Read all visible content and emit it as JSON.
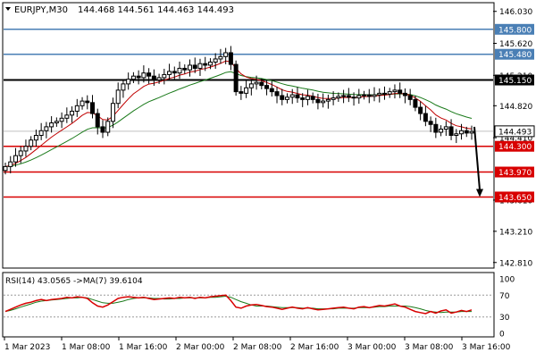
{
  "header": {
    "symbol": "EURJPY,M30",
    "ohlc": "144.468 144.561 144.463 144.493"
  },
  "rsi_header": "RSI(14) 43.0565  ->MA(7) 39.6104",
  "colors": {
    "bull": "#000000",
    "bear": "#000000",
    "ma_fast": "#c00000",
    "ma_slow": "#1a7a1a",
    "resistance_blue": "#4a7fb5",
    "pivot": "#000000",
    "support_red": "#d80000",
    "rsi_line": "#d80000",
    "rsi_ma": "#1a7a1a",
    "arrow": "#000000"
  },
  "chart_data": [
    {
      "type": "candlestick",
      "title": "EURJPY,M30",
      "ylim": [
        142.75,
        146.13
      ],
      "y_ticks": [
        "146.030",
        "145.620",
        "145.210",
        "144.820",
        "144.410",
        "143.610",
        "143.210",
        "142.810"
      ],
      "x_tick_labels": [
        "1 Mar 2023",
        "1 Mar 08:00",
        "1 Mar 16:00",
        "2 Mar 00:00",
        "2 Mar 08:00",
        "2 Mar 16:00",
        "3 Mar 00:00",
        "3 Mar 08:00",
        "3 Mar 16:00"
      ],
      "hlines": [
        {
          "value": 145.8,
          "label": "145.800",
          "kind": "resistance_blue"
        },
        {
          "value": 145.48,
          "label": "145.480",
          "kind": "resistance_blue"
        },
        {
          "value": 145.15,
          "label": "145.150",
          "kind": "pivot"
        },
        {
          "value": 144.3,
          "label": "144.300",
          "kind": "support_red"
        },
        {
          "value": 143.97,
          "label": "143.970",
          "kind": "support_red"
        },
        {
          "value": 143.65,
          "label": "143.650",
          "kind": "support_red"
        }
      ],
      "current_price": {
        "value": 144.493,
        "label": "144.493"
      },
      "arrow": {
        "from": 144.55,
        "to": 143.65
      },
      "close": [
        144.04,
        144.1,
        144.18,
        144.24,
        144.3,
        144.38,
        144.44,
        144.5,
        144.55,
        144.6,
        144.62,
        144.66,
        144.7,
        144.75,
        144.82,
        144.88,
        144.86,
        144.72,
        144.55,
        144.48,
        144.62,
        144.85,
        145.02,
        145.1,
        145.16,
        145.2,
        145.18,
        145.24,
        145.2,
        145.15,
        145.18,
        145.22,
        145.26,
        145.24,
        145.3,
        145.28,
        145.34,
        145.3,
        145.36,
        145.34,
        145.38,
        145.42,
        145.45,
        145.5,
        145.35,
        145.0,
        144.98,
        145.05,
        145.1,
        145.12,
        145.08,
        145.04,
        145.0,
        144.95,
        144.9,
        144.93,
        144.96,
        144.92,
        144.9,
        144.94,
        144.9,
        144.86,
        144.88,
        144.9,
        144.92,
        144.94,
        144.95,
        144.93,
        144.92,
        144.95,
        144.96,
        144.94,
        144.96,
        144.98,
        144.97,
        145.0,
        145.02,
        144.98,
        144.95,
        144.9,
        144.8,
        144.72,
        144.62,
        144.58,
        144.48,
        144.52,
        144.55,
        144.44,
        144.46,
        144.5,
        144.47,
        144.49
      ],
      "rsi": {
        "ylim": [
          0,
          100
        ],
        "levels": [
          70,
          30
        ],
        "y_ticks": [
          "100",
          "70",
          "30",
          "0"
        ],
        "rsi_values": [
          40,
          44,
          48,
          52,
          55,
          57,
          60,
          62,
          60,
          62,
          63,
          64,
          66,
          65,
          67,
          66,
          64,
          56,
          50,
          48,
          52,
          58,
          64,
          66,
          67,
          66,
          65,
          66,
          64,
          62,
          63,
          64,
          65,
          64,
          66,
          65,
          66,
          64,
          66,
          65,
          67,
          68,
          69,
          70,
          60,
          48,
          46,
          50,
          52,
          53,
          51,
          49,
          48,
          46,
          44,
          46,
          48,
          46,
          45,
          47,
          45,
          43,
          44,
          45,
          46,
          47,
          48,
          46,
          45,
          48,
          49,
          47,
          49,
          51,
          50,
          52,
          54,
          50,
          48,
          44,
          40,
          38,
          36,
          40,
          37,
          41,
          43,
          37,
          39,
          42,
          40,
          43
        ],
        "ma_values": [
          40,
          42,
          45,
          48,
          51,
          54,
          57,
          59,
          60,
          61,
          62,
          63,
          64,
          65,
          65,
          66,
          65,
          62,
          59,
          56,
          55,
          55,
          57,
          59,
          62,
          64,
          65,
          65,
          65,
          64,
          64,
          63,
          63,
          64,
          64,
          65,
          65,
          65,
          65,
          65,
          66,
          66,
          67,
          68,
          66,
          62,
          58,
          55,
          52,
          50,
          50,
          50,
          49,
          48,
          47,
          47,
          47,
          47,
          46,
          46,
          46,
          45,
          45,
          45,
          45,
          46,
          46,
          46,
          46,
          47,
          47,
          47,
          48,
          49,
          49,
          50,
          50,
          50,
          50,
          49,
          47,
          45,
          42,
          40,
          39,
          38,
          39,
          39,
          39,
          40,
          40,
          40
        ]
      }
    }
  ]
}
